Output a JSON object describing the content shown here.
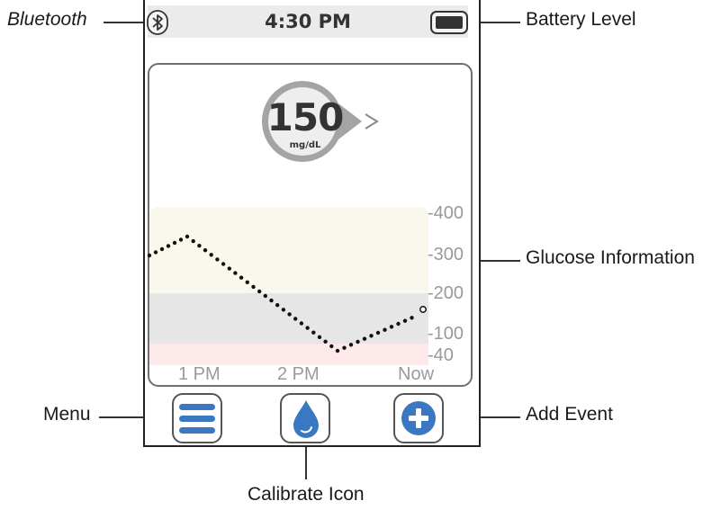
{
  "status_bar": {
    "time": "4:30 PM",
    "bluetooth_icon": "bluetooth-icon",
    "battery_icon": "battery-full-icon"
  },
  "reading": {
    "value": "150",
    "unit": "mg/dL",
    "trend_icon": "trend-arrow-right-icon"
  },
  "graph": {
    "y_ticks": [
      "-400",
      "-300",
      "-200",
      "-100",
      "-40"
    ],
    "x_ticks": [
      "1 PM",
      "2 PM",
      "Now"
    ],
    "zone_colors": {
      "high": "#faf7ec",
      "target": "#e6e6e6",
      "low": "#fde9ea"
    }
  },
  "buttons": {
    "menu_icon": "menu-icon",
    "calibrate_icon": "calibrate-drop-icon",
    "add_event_icon": "add-event-icon",
    "accent": "#3a78c2"
  },
  "callouts": {
    "bluetooth": "Bluetooth",
    "battery": "Battery Level",
    "glucose": "Glucose Information",
    "menu": "Menu",
    "add_event": "Add Event",
    "calibrate": "Calibrate Icon"
  }
}
